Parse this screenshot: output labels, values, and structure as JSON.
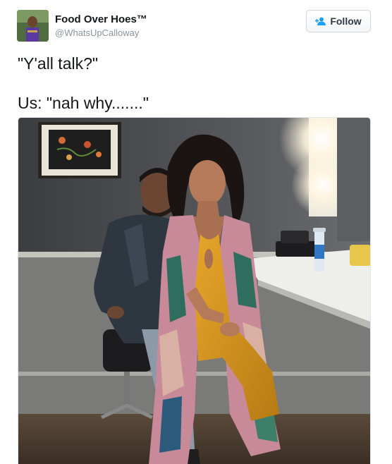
{
  "user": {
    "display_name": "Food Over Hoes™",
    "handle": "@WhatsUpCalloway",
    "avatar_icon": "profile-photo"
  },
  "follow_button": {
    "icon": "add-user-icon",
    "label": "Follow",
    "accent": "#1da1f2"
  },
  "tweet": {
    "line1": "\"Y'all talk?\"",
    "line2": "Us: \"nah why.......\""
  },
  "media": {
    "alt": "photo",
    "bottle_label": "smart water"
  }
}
